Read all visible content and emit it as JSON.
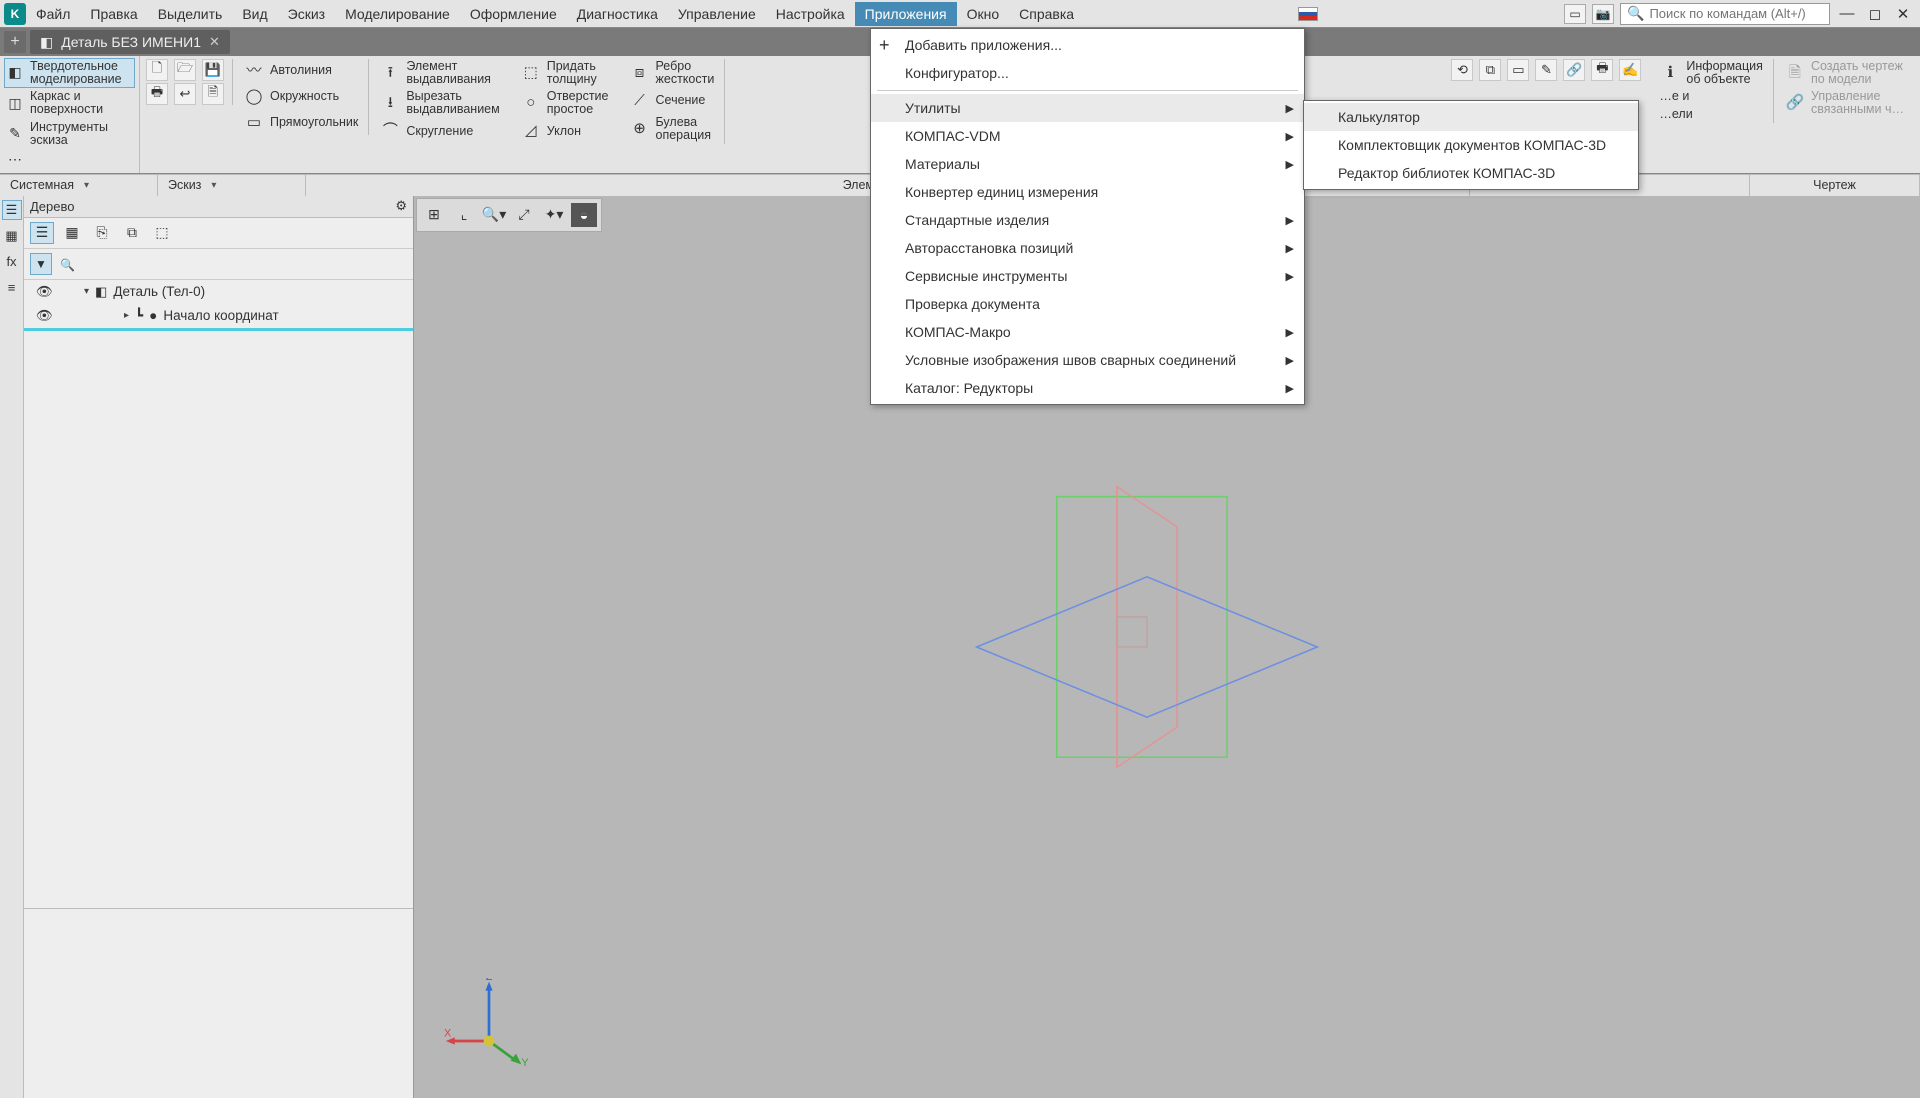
{
  "menubar": {
    "items": [
      "Файл",
      "Правка",
      "Выделить",
      "Вид",
      "Эскиз",
      "Моделирование",
      "Оформление",
      "Диагностика",
      "Управление",
      "Настройка",
      "Приложения",
      "Окно",
      "Справка"
    ],
    "active_index": 10,
    "search_placeholder": "Поиск по командам (Alt+/)"
  },
  "tabs": {
    "plus": "+",
    "tab1": {
      "title": "Деталь БЕЗ ИМЕНИ1"
    }
  },
  "ribbon_left": {
    "items": [
      {
        "icon": "◧",
        "line1": "Твердотельное",
        "line2": "моделирование",
        "active": true
      },
      {
        "icon": "◫",
        "line1": "Каркас и",
        "line2": "поверхности"
      },
      {
        "icon": "✎",
        "line1": "Инструменты",
        "line2": "эскиза"
      },
      {
        "icon": "⋯",
        "line1": "",
        "line2": ""
      }
    ]
  },
  "ribbon": {
    "file": {
      "new": "🗋",
      "open": "🗁",
      "save": "💾",
      "print": "🖶",
      "arrow": "↩",
      "doc": "🗎"
    },
    "sketch": {
      "r0": {
        "icon": "〰",
        "label": "Автолиния"
      },
      "r1": {
        "icon": "◯",
        "label": "Окружность"
      },
      "r2": {
        "icon": "▭",
        "label": "Прямоугольник"
      }
    },
    "body": [
      {
        "icon": "⭱",
        "line1": "Элемент",
        "line2": "выдавливания"
      },
      {
        "icon": "⭳",
        "line1": "Вырезать",
        "line2": "выдавливанием"
      },
      {
        "icon": "⌒",
        "line1": "Скругление",
        "line2": ""
      },
      {
        "icon": "⬚",
        "line1": "Придать",
        "line2": "толщину"
      },
      {
        "icon": "○",
        "line1": "Отверстие",
        "line2": "простое"
      },
      {
        "icon": "◿",
        "line1": "Уклон",
        "line2": ""
      },
      {
        "icon": "⧈",
        "line1": "Ребро",
        "line2": "жесткости"
      },
      {
        "icon": "⟋",
        "line1": "Сечение",
        "line2": ""
      },
      {
        "icon": "⊕",
        "line1": "Булева",
        "line2": "операция"
      }
    ],
    "right": [
      {
        "icon": "ℹ",
        "line1": "Информация",
        "line2": "об объекте"
      },
      {
        "label": "…е и"
      },
      {
        "label": "…ели"
      }
    ],
    "drawing": [
      {
        "icon": "🗎",
        "line1": "Создать чертеж",
        "line2": "по модели",
        "dim": true
      },
      {
        "icon": "🔗",
        "line1": "Управление",
        "line2": "связанными ч…",
        "dim": true
      }
    ]
  },
  "ribbon_footer": {
    "cells": [
      "Системная",
      "Эскиз",
      "Элементы тела",
      "",
      "",
      "Чертеж"
    ]
  },
  "treepanel": {
    "title": "Дерево",
    "gear": "⚙",
    "toolbar": [
      "☰",
      "▦",
      "⎘",
      "⧉",
      "⬚"
    ],
    "root": {
      "caret": "▾",
      "icon": "◧",
      "label": "Деталь (Тел-0)"
    },
    "child": {
      "caret": "▸",
      "icon": "┗",
      "dot": "●",
      "label": "Начало координат"
    },
    "eye": "👁"
  },
  "dropdown1": {
    "items": [
      {
        "label": "Добавить приложения...",
        "plus": true
      },
      {
        "label": "Конфигуратор..."
      },
      {
        "label": "Утилиты",
        "sub": true,
        "hover": true
      },
      {
        "label": "КОМПАС-VDM",
        "sub": true
      },
      {
        "label": "Материалы",
        "sub": true
      },
      {
        "label": "Конвертер единиц измерения"
      },
      {
        "label": "Стандартные изделия",
        "sub": true
      },
      {
        "label": "Авторасстановка позиций",
        "sub": true
      },
      {
        "label": "Сервисные инструменты",
        "sub": true
      },
      {
        "label": "Проверка документа"
      },
      {
        "label": "КОМПАС-Макро",
        "sub": true
      },
      {
        "label": "Условные изображения швов сварных соединений",
        "sub": true
      },
      {
        "label": "Каталог: Редукторы",
        "sub": true
      }
    ]
  },
  "dropdown2": {
    "items": [
      {
        "label": "Калькулятор",
        "hover": true
      },
      {
        "label": "Комплектовщик документов КОМПАС-3D"
      },
      {
        "label": "Редактор библиотек КОМПАС-3D"
      }
    ]
  },
  "triad": {
    "x": "X",
    "y": "Y",
    "z": "Z"
  }
}
